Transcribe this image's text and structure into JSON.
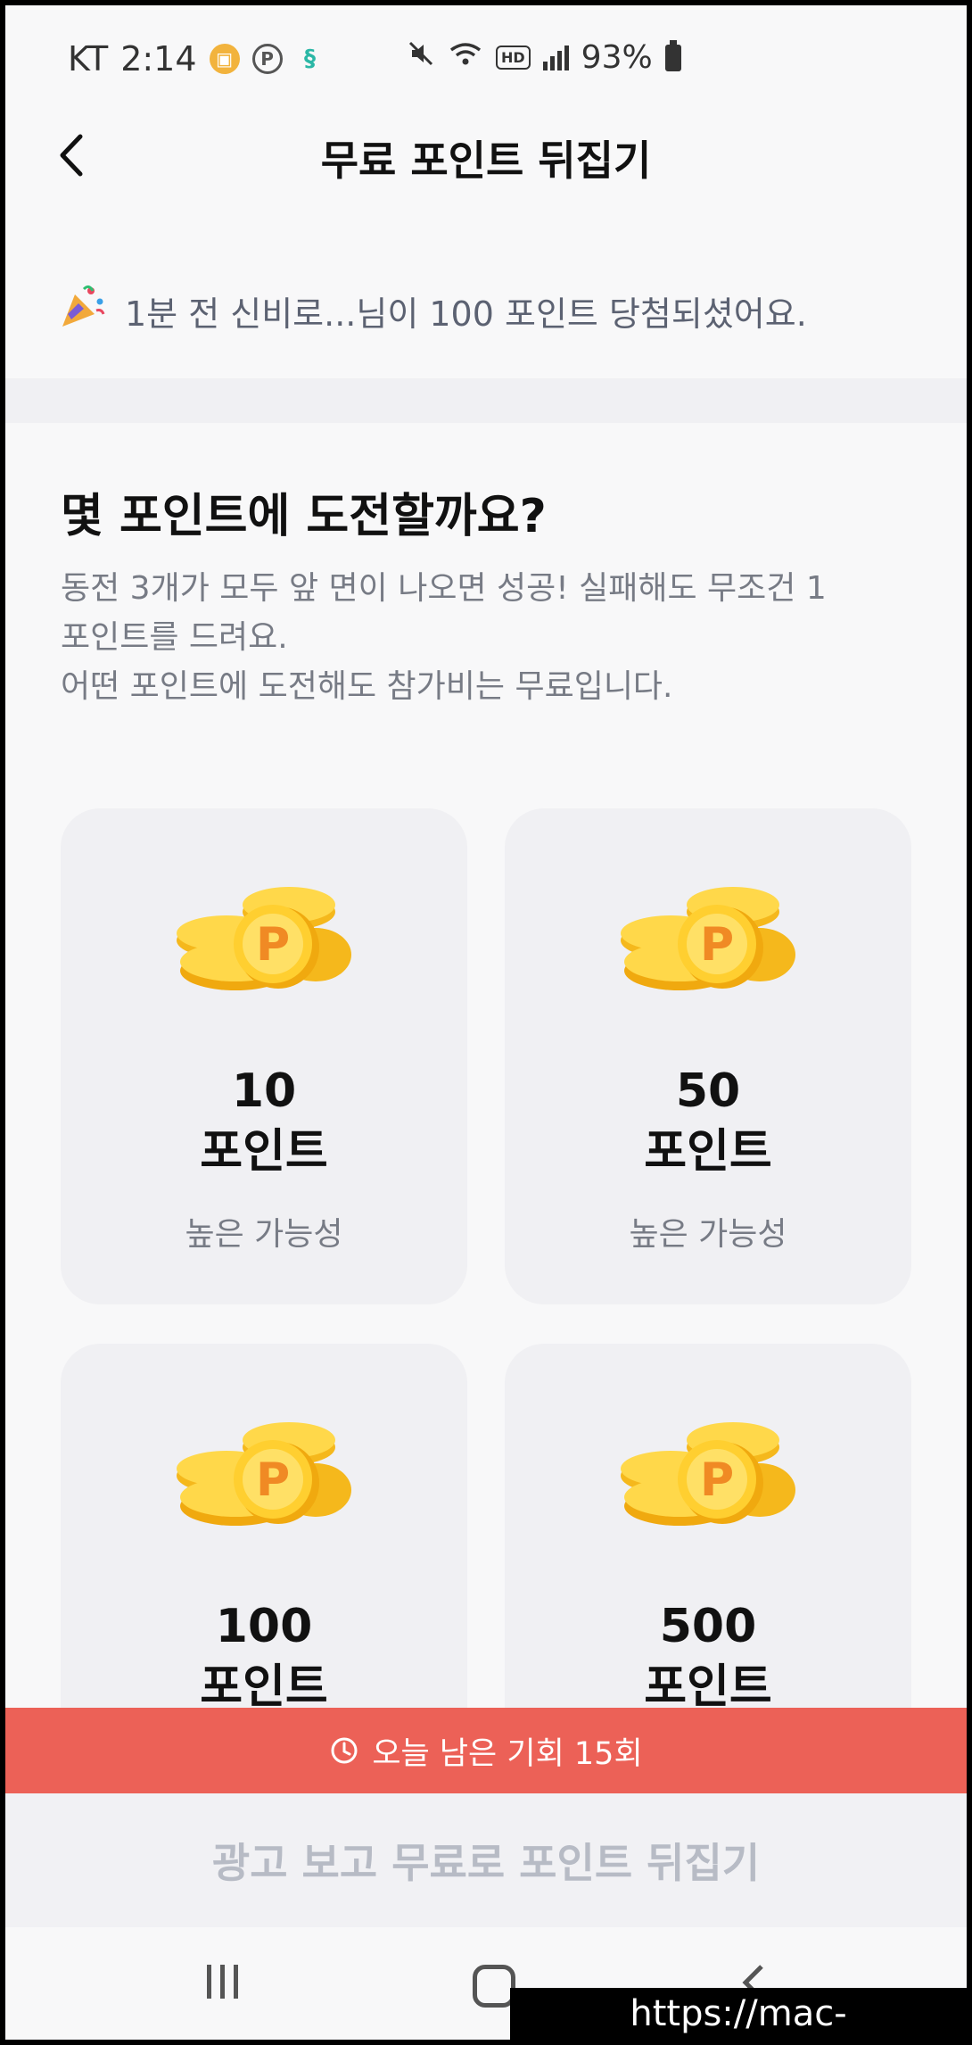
{
  "status_bar": {
    "carrier": "KT",
    "time": "2:14",
    "battery_percent": "93%",
    "left_icons": [
      "notification-coin-icon",
      "p-badge-icon",
      "footprint-icon"
    ],
    "right_icons": [
      "mute-icon",
      "wifi-icon",
      "hd-icon",
      "signal-icon",
      "battery-icon"
    ],
    "hd_label": "HD"
  },
  "header": {
    "title": "무료 포인트 뒤집기",
    "back_icon": "chevron-left-icon"
  },
  "ticker": {
    "icon": "party-popper-icon",
    "message": "1분 전 신비로...님이 100 포인트 당첨되셨어요."
  },
  "section": {
    "title": "몇 포인트에 도전할까요?",
    "description_lines": [
      "동전 3개가 모두 앞 면이 나오면 성공! 실패해도 무조건 1",
      "포인트를 드려요.",
      "어떤 포인트에 도전해도 참가비는 무료입니다."
    ]
  },
  "cards": [
    {
      "points": "10",
      "unit": "포인트",
      "odds": "높은 가능성"
    },
    {
      "points": "50",
      "unit": "포인트",
      "odds": "높은 가능성"
    },
    {
      "points": "100",
      "unit": "포인트",
      "odds": ""
    },
    {
      "points": "500",
      "unit": "포인트",
      "odds": ""
    }
  ],
  "remaining": {
    "icon": "clock-icon",
    "text": "오늘 남은 기회 15회"
  },
  "cta": {
    "label": "광고 보고 무료로 포인트 뒤집기"
  },
  "watermark": "https://mac-os.tistory.com",
  "colors": {
    "banner": "#ec6157",
    "coin": "#f7c624",
    "coin_letter": "#f08a24",
    "card_bg": "#f0f0f3",
    "cta_text": "#b7bbc5"
  }
}
